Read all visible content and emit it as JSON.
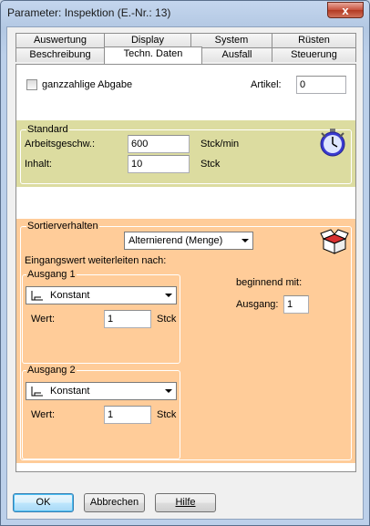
{
  "window": {
    "title": "Parameter: Inspektion (E.-Nr.:  13)",
    "close_symbol": "x"
  },
  "tabs": {
    "row_back": [
      "Auswertung",
      "Display",
      "System",
      "Rüsten"
    ],
    "row_front": [
      "Beschreibung",
      "Techn. Daten",
      "Ausfall",
      "Steuerung"
    ],
    "active": "Techn. Daten"
  },
  "top": {
    "ganzzahlig_label": "ganzzahlige Abgabe",
    "ganzzahlig_checked": false,
    "artikel_label": "Artikel:",
    "artikel_value": "0"
  },
  "standard": {
    "title": "Standard",
    "arbeits_label": "Arbeitsgeschw.:",
    "arbeits_value": "600",
    "arbeits_unit": "Stck/min",
    "inhalt_label": "Inhalt:",
    "inhalt_value": "10",
    "inhalt_unit": "Stck",
    "icon": "stopwatch-icon",
    "bg_color": "#dcdca0"
  },
  "sortier": {
    "title": "Sortierverhalten",
    "mode_value": "Alternierend (Menge)",
    "icon": "box-icon",
    "weiterleiten_label": "Eingangswert weiterleiten nach:",
    "bg_color": "#ffcc99",
    "ausgang1": {
      "title": "Ausgang 1",
      "dist_value": "Konstant",
      "wert_label": "Wert:",
      "wert_value": "1",
      "unit": "Stck"
    },
    "ausgang2": {
      "title": "Ausgang 2",
      "dist_value": "Konstant",
      "wert_label": "Wert:",
      "wert_value": "1",
      "unit": "Stck"
    },
    "beginnend_label": "beginnend mit:",
    "ausgang_label": "Ausgang:",
    "ausgang_value": "1"
  },
  "buttons": {
    "ok": "OK",
    "abbrechen": "Abbrechen",
    "hilfe": "Hilfe"
  }
}
